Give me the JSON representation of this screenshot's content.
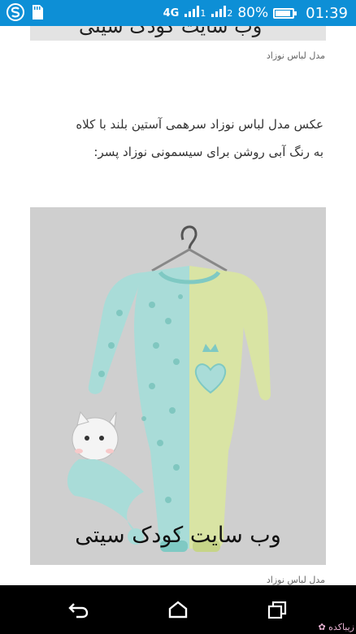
{
  "statusbar": {
    "network": "4G",
    "sim1": "1",
    "sim2": "2",
    "battery_text": "80%",
    "battery_level": 0.8,
    "time": "01:39",
    "icons": [
      "app-s-icon",
      "sd-card-icon",
      "signal-icon",
      "battery-icon"
    ]
  },
  "article": {
    "top_image_watermark": "وب سایت کودک سیتی",
    "caption_1": "مدل لباس نوزاد",
    "paragraph_line1": "عکس مدل لباس نوزاد سرهمی آستین بلند با کلاه",
    "paragraph_line2": "به رنگ آبی روشن برای سیسمونی نوزاد پسر:",
    "photo_watermark": "وب سایت کودک سیتی",
    "caption_2": "مدل لباس نوزاد"
  },
  "navbar": {
    "buttons": [
      "back-icon",
      "home-icon",
      "recents-icon"
    ],
    "corner_logo": "زیباکده"
  },
  "colors": {
    "statusbar": "#0d8fd6",
    "navbar": "#000000",
    "photo_bg": "#cfcfcf",
    "onesie_blue": "#a9dcd8",
    "onesie_yellow": "#d9e4a4"
  }
}
